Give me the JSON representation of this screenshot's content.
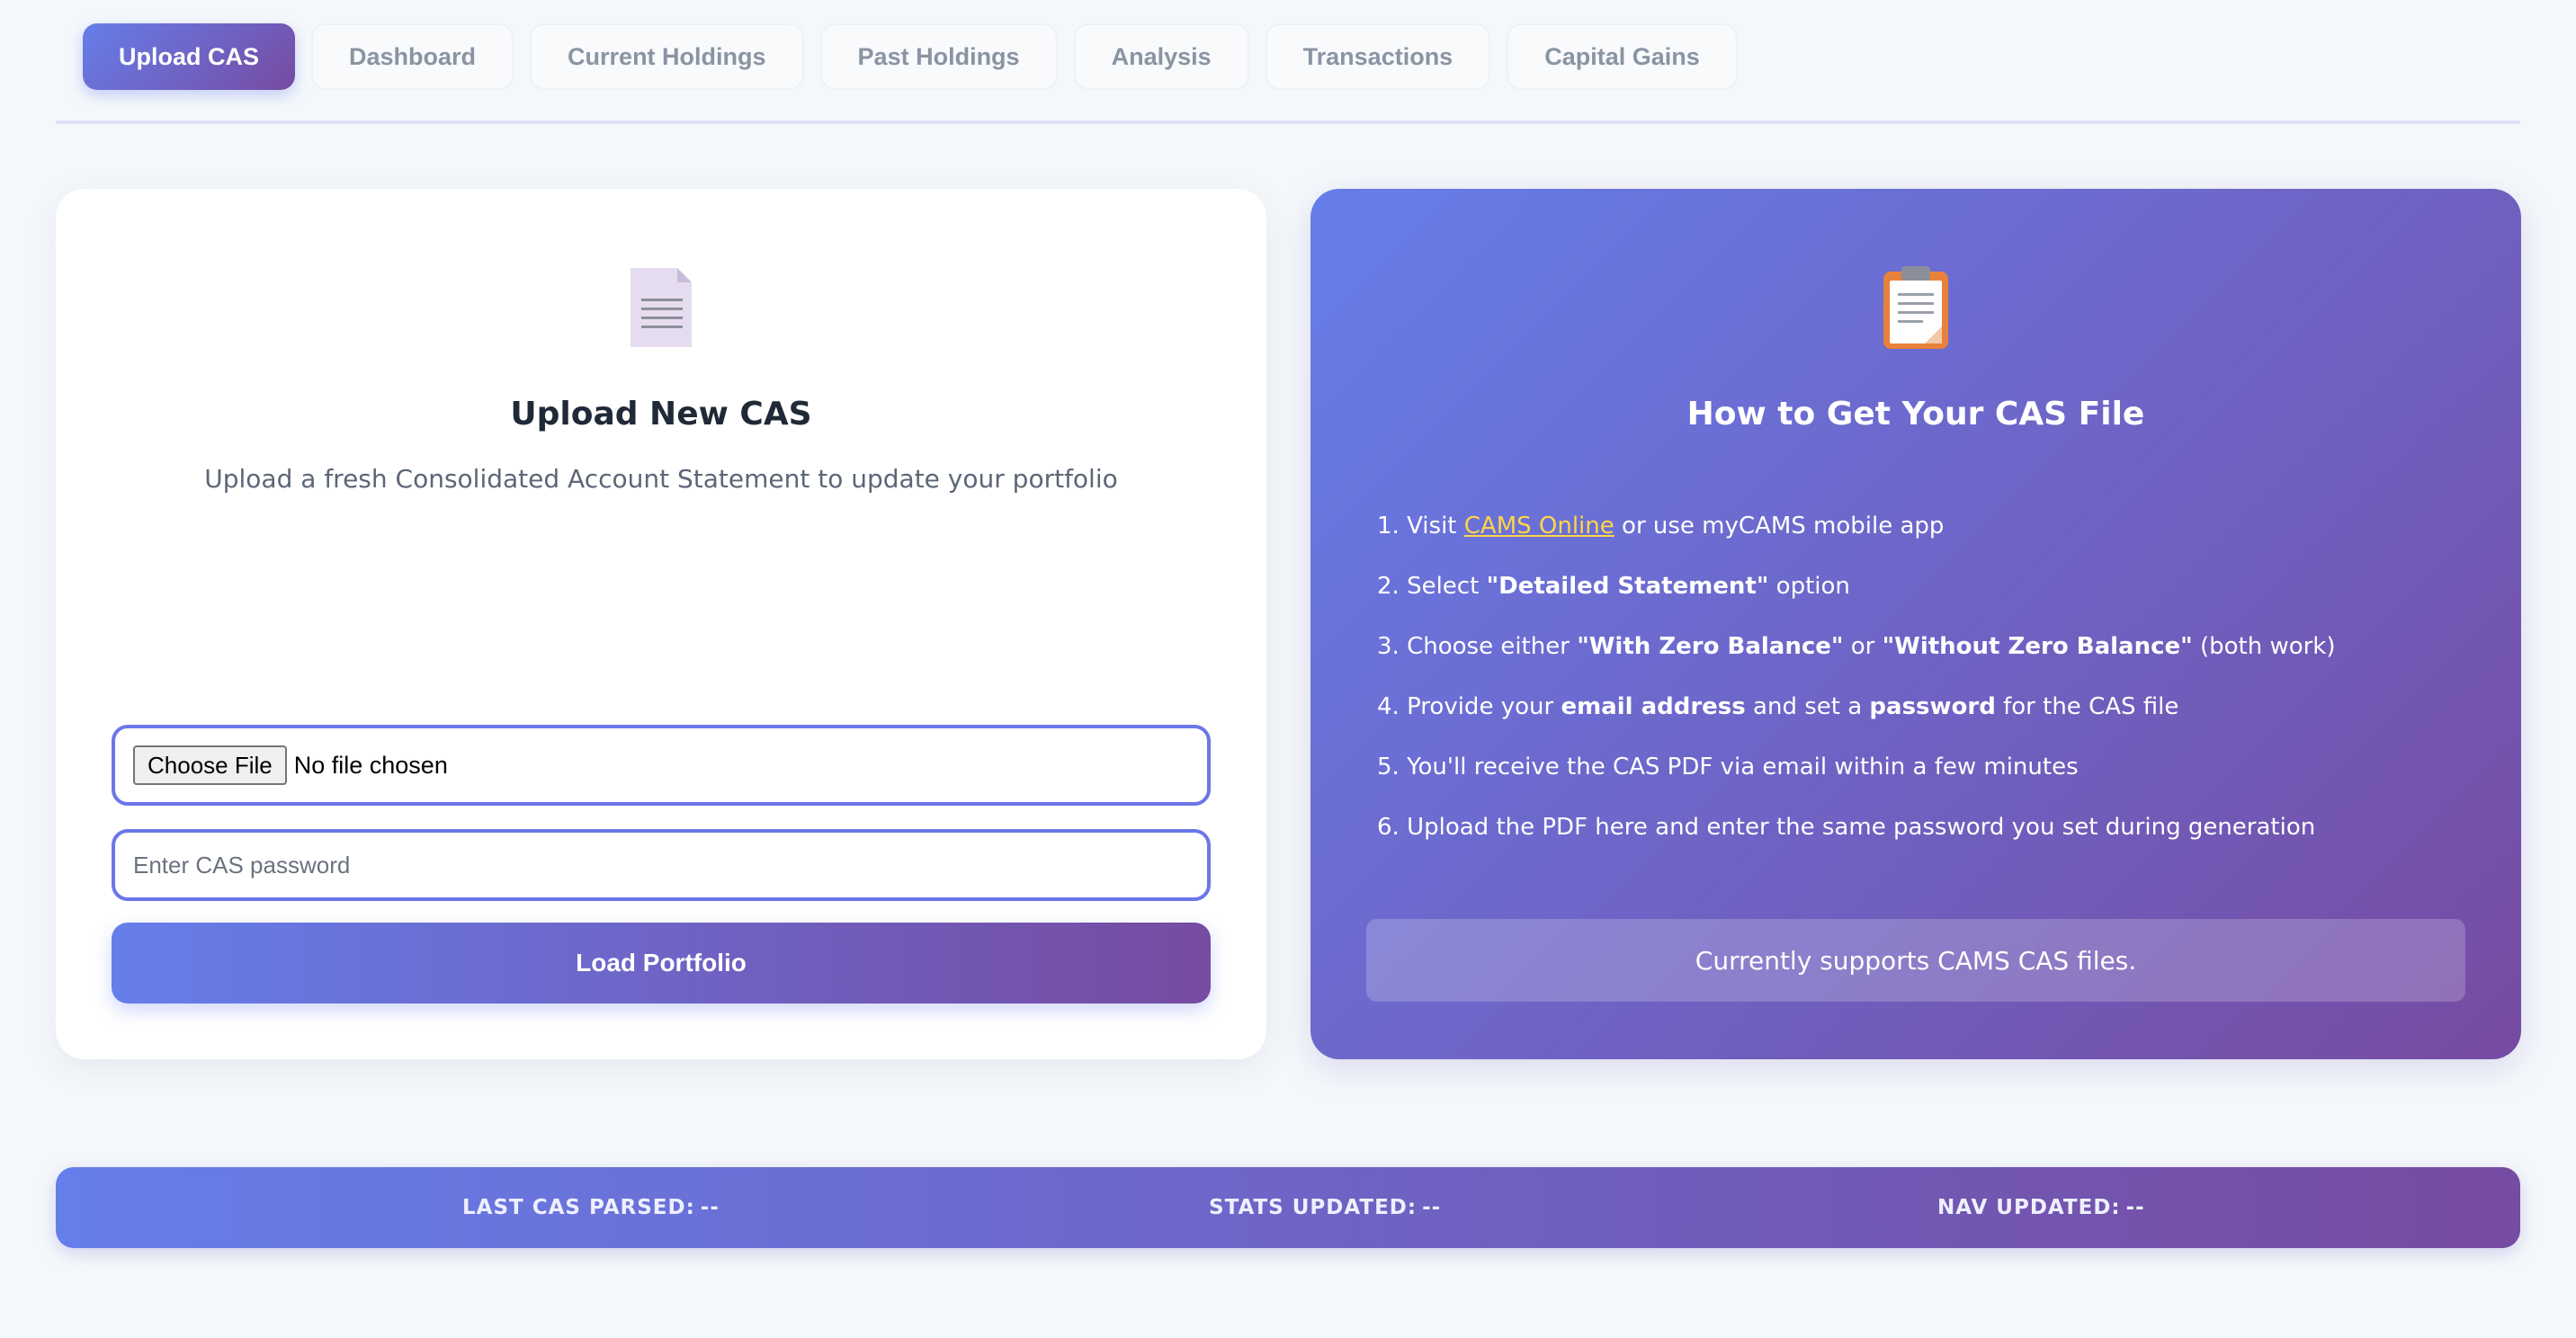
{
  "tabs": [
    {
      "label": "Upload CAS",
      "active": true
    },
    {
      "label": "Dashboard",
      "active": false
    },
    {
      "label": "Current Holdings",
      "active": false
    },
    {
      "label": "Past Holdings",
      "active": false
    },
    {
      "label": "Analysis",
      "active": false
    },
    {
      "label": "Transactions",
      "active": false
    },
    {
      "label": "Capital Gains",
      "active": false
    }
  ],
  "upload_card": {
    "icon": "document-icon",
    "title": "Upload New CAS",
    "subtitle": "Upload a fresh Consolidated Account Statement to update your portfolio",
    "file_button_label": "Choose File",
    "file_status": "No file chosen",
    "password_placeholder": "Enter CAS password",
    "load_button_label": "Load Portfolio"
  },
  "help_card": {
    "icon": "clipboard-icon",
    "title": "How to Get Your CAS File",
    "steps": [
      {
        "num": "1.",
        "pre": "Visit ",
        "link": "CAMS Online",
        "post": " or use myCAMS mobile app"
      },
      {
        "num": "2.",
        "pre": "Select ",
        "bold": "\"Detailed Statement\"",
        "post": " option"
      },
      {
        "num": "3.",
        "pre": "Choose either ",
        "bold": "\"With Zero Balance\"",
        "mid": " or ",
        "bold2": "\"Without Zero Balance\"",
        "post": " (both work)"
      },
      {
        "num": "4.",
        "pre": "Provide your ",
        "bold": "email address",
        "mid": " and set a ",
        "bold2": "password",
        "post": " for the CAS file"
      },
      {
        "num": "5.",
        "pre": "You'll receive the CAS PDF via email within a few minutes"
      },
      {
        "num": "6.",
        "pre": "Upload the PDF here and enter the same password you set during generation"
      }
    ],
    "support_note": "Currently supports CAMS CAS files."
  },
  "status_bar": {
    "last_cas_label": "LAST CAS PARSED:",
    "last_cas_value": "--",
    "stats_label": "STATS UPDATED:",
    "stats_value": "--",
    "nav_label": "NAV UPDATED:",
    "nav_value": "--"
  },
  "colors": {
    "accent_start": "#667eea",
    "accent_end": "#764ba2",
    "link": "#ffd54a",
    "background": "#f5f8fb"
  }
}
